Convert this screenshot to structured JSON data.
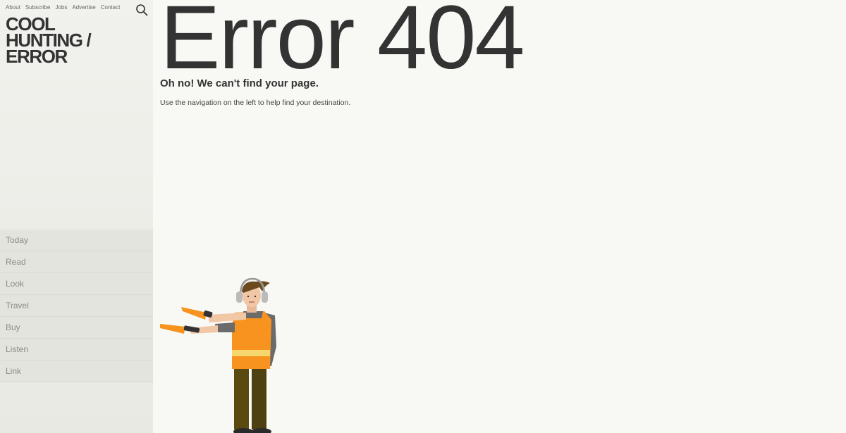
{
  "header": {
    "nav_links": [
      "About",
      "Subscribe",
      "Jobs",
      "Advertise",
      "Contact"
    ],
    "search_icon": "search-icon"
  },
  "logo": {
    "line1": "COOL",
    "line2": "HUNTING /",
    "line3": "ERROR"
  },
  "sidebar": {
    "items": [
      {
        "label": "Today"
      },
      {
        "label": "Read"
      },
      {
        "label": "Look"
      },
      {
        "label": "Travel"
      },
      {
        "label": "Buy"
      },
      {
        "label": "Listen"
      },
      {
        "label": "Link"
      }
    ]
  },
  "main": {
    "title": "Error 404",
    "subtitle": "Oh no! We can't find your page.",
    "message": "Use the navigation on the left to help find your destination."
  },
  "colors": {
    "sidebar_bg": "#eeeeea",
    "main_bg": "#f8f8f4",
    "text": "#333333",
    "vest_orange": "#f7931e",
    "pants": "#5a4a10"
  }
}
